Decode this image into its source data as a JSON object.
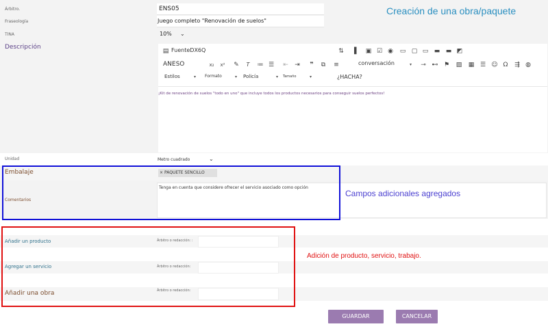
{
  "title": "Creación de una obra/paquete",
  "fields": {
    "code": {
      "label": "Árbitro.",
      "value": "ENS05"
    },
    "phrase": {
      "label": "Fraseología",
      "value": "Juego completo \"Renovación de suelos\""
    },
    "tina": {
      "label": "TINA",
      "value": "10%"
    },
    "description": {
      "label": "Descripción",
      "text": "¡Kit de renovación de suelos \"todo en uno\" que incluye todos los productos necesarios para conseguir suelos perfectos!"
    },
    "unit": {
      "label": "Unidad",
      "value": "Metro cuadrado"
    },
    "packaging": {
      "label": "Embalaje",
      "value": "PAQUETE SENCILLO"
    },
    "comments": {
      "label": "Comentarios",
      "value": "Tenga en cuenta que considere ofrecer el servicio asociado como opción"
    }
  },
  "toolbar": {
    "source_label": "FuenteDX6Q",
    "aneso": "ANESO",
    "conversacion": "conversación",
    "estilos": "Estilos",
    "formato": "Formato",
    "policia": "Policía",
    "tamano": "Tamaño",
    "hacha": "¿HACHA?"
  },
  "additions": {
    "product": {
      "label": "Añadir un producto",
      "hint": "Árbitro o redacción: :"
    },
    "service": {
      "label": "Agregar un servicio",
      "hint": "Árbitro o redacción:"
    },
    "work": {
      "label": "Añadir una obra",
      "hint": "Árbitro o redacción:"
    }
  },
  "buttons": {
    "save": "GUARDAR",
    "cancel": "CANCELAR"
  },
  "annotations": {
    "additional_fields": "Campos adicionales agregados",
    "addition": "Adición de producto, servicio, trabajo."
  },
  "colors": {
    "accent": "#9b7bb0",
    "blue_box": "#1010d8",
    "red_box": "#e01010",
    "title_color": "#2a8fc0",
    "annotation_blue": "#4a3fd0",
    "annotation_red": "#e01010"
  }
}
